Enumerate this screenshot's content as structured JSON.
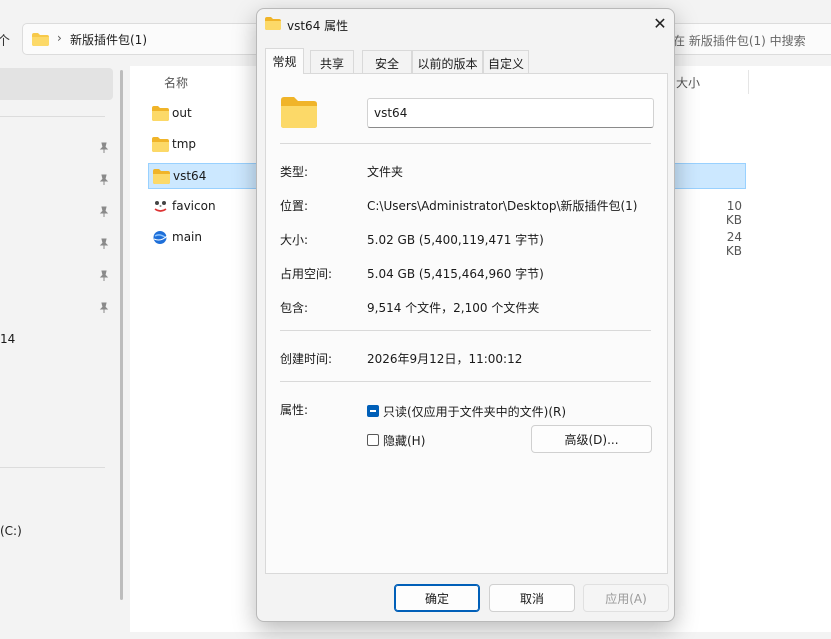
{
  "explorer": {
    "breadcrumb_chevron": "›",
    "address_path": "新版插件包(1)",
    "search_placeholder": "在 新版插件包(1) 中搜索",
    "nav_arrow": "个",
    "sidebar_labels": [
      "14",
      "(C:)"
    ],
    "columns": {
      "name": "名称",
      "size": "大小"
    },
    "files": [
      {
        "name": "out",
        "icon": "folder-icon",
        "size": ""
      },
      {
        "name": "tmp",
        "icon": "folder-icon",
        "size": ""
      },
      {
        "name": "vst64",
        "icon": "folder-icon",
        "size": "",
        "selected": true
      },
      {
        "name": "favicon",
        "icon": "favicon-icon",
        "size": "10 KB"
      },
      {
        "name": "main",
        "icon": "html-file-icon",
        "size": "24 KB"
      }
    ]
  },
  "dialog": {
    "title": "vst64 属性",
    "close_glyph": "✕",
    "tabs": [
      "常规",
      "共享",
      "安全",
      "以前的版本",
      "自定义"
    ],
    "active_tab": "常规",
    "folder_name": "vst64",
    "fields": [
      {
        "label": "类型:",
        "value": "文件夹"
      },
      {
        "label": "位置:",
        "value": "C:\\Users\\Administrator\\Desktop\\新版插件包(1)"
      },
      {
        "label": "大小:",
        "value": "5.02 GB (5,400,119,471 字节)"
      },
      {
        "label": "占用空间:",
        "value": "5.04 GB (5,415,464,960 字节)"
      },
      {
        "label": "包含:",
        "value": "9,514 个文件，2,100 个文件夹"
      },
      {
        "label": "创建时间:",
        "value": "2026年9月12日，11:00:12"
      }
    ],
    "attributes_label": "属性:",
    "readonly_label": "只读(仅应用于文件夹中的文件)(R)",
    "readonly_state": "indeterminate",
    "hidden_label": "隐藏(H)",
    "hidden_state": "unchecked",
    "advanced_button": "高级(D)...",
    "buttons": {
      "ok": "确定",
      "cancel": "取消",
      "apply": "应用(A)"
    }
  },
  "colors": {
    "accent": "#005fb8",
    "folder": "#f7c94a",
    "selection": "#cce8ff"
  }
}
